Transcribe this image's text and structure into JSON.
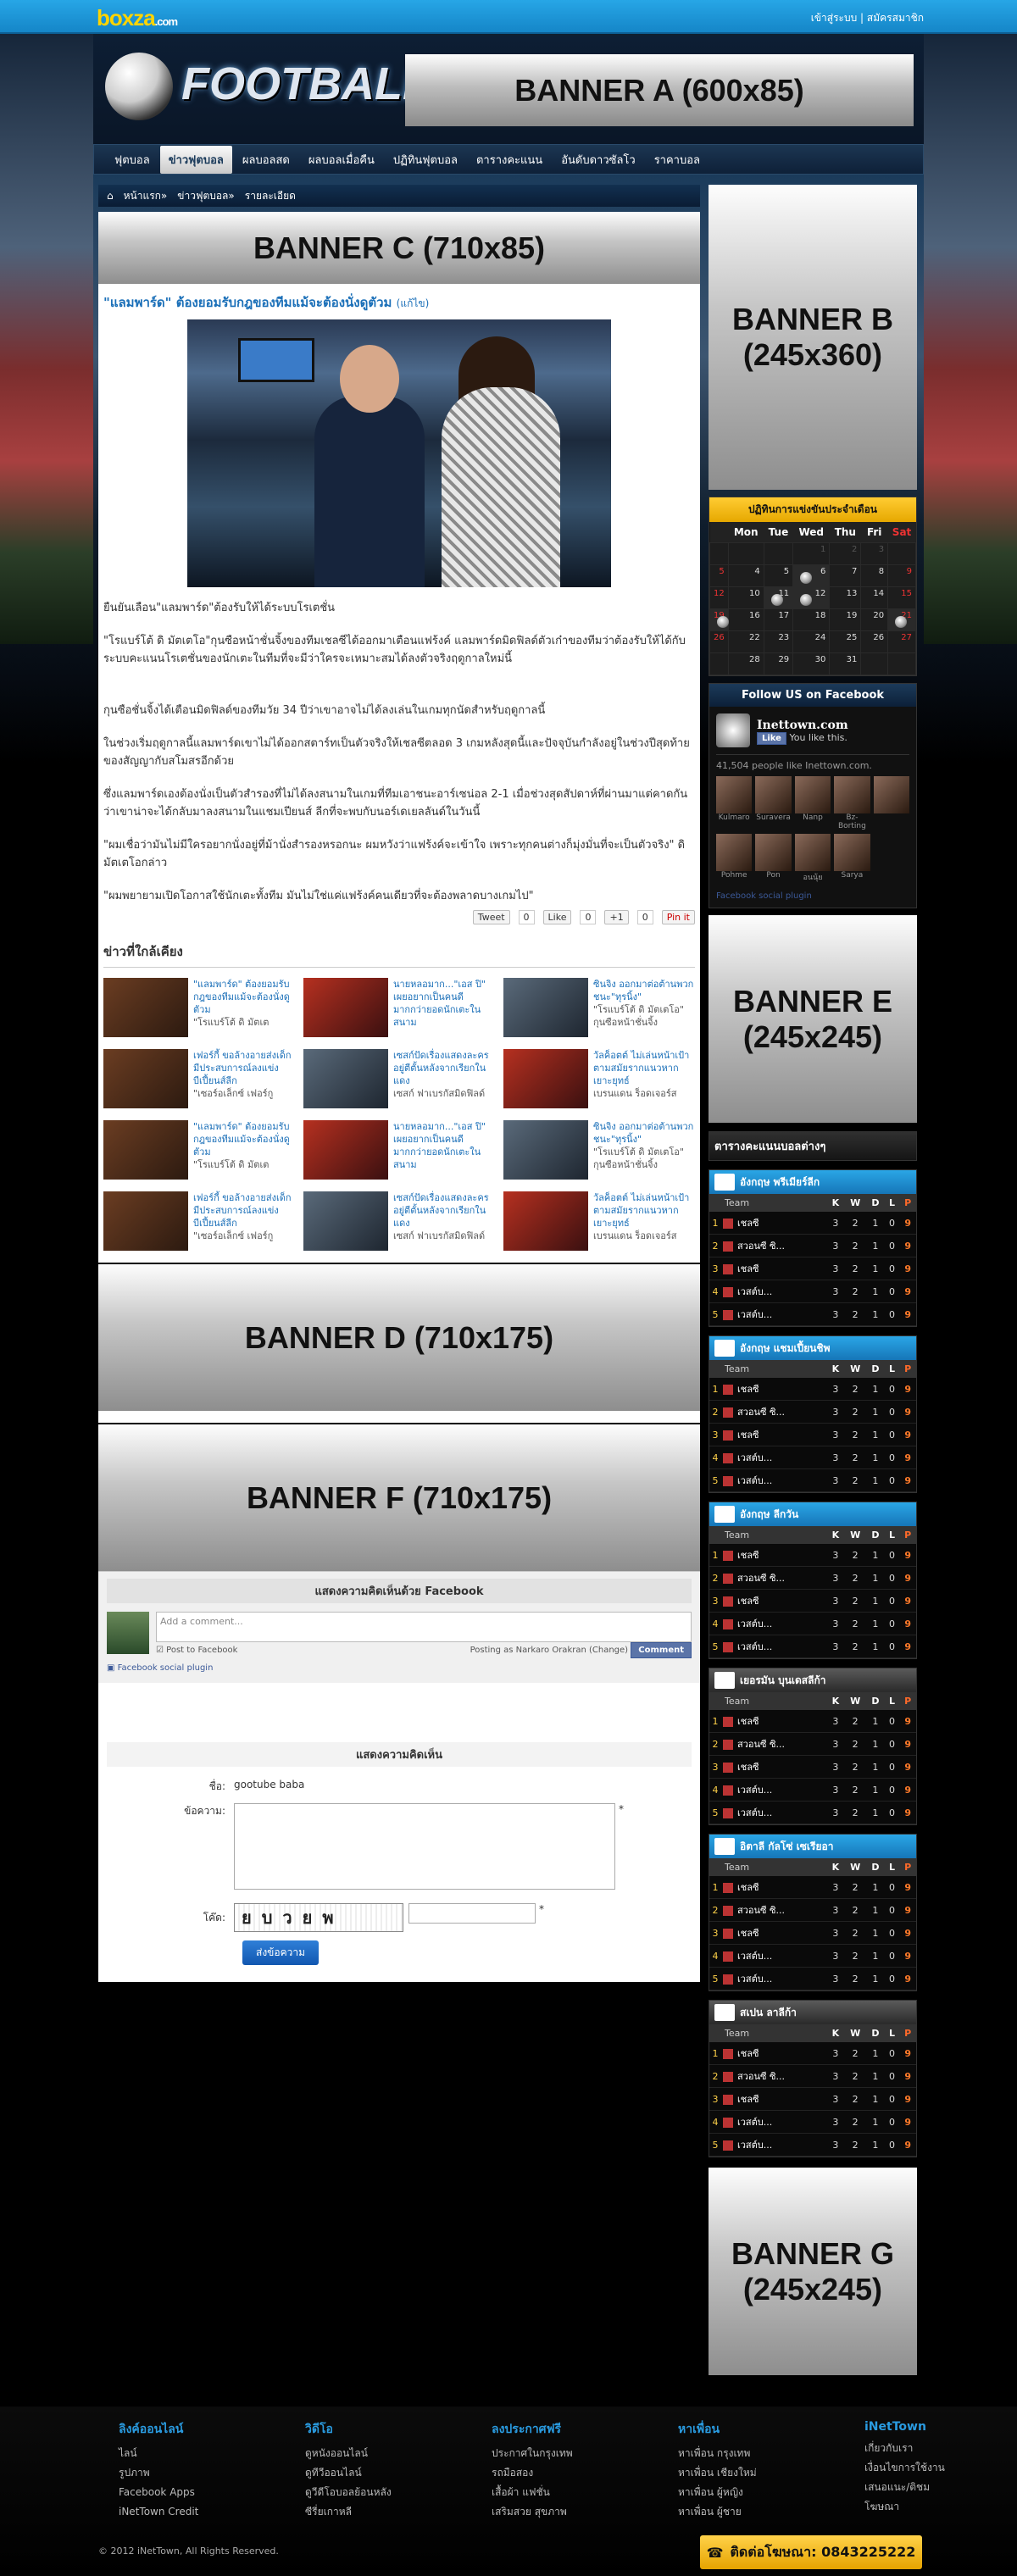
{
  "topbar": {
    "logo": "boxza",
    "logo_suffix": ".com",
    "login": "เข้าสู่ระบบ",
    "register": "สมัครสมาชิก"
  },
  "header": {
    "title": "FOOTBALL",
    "bannerA": "BANNER A (600x85)"
  },
  "nav": [
    "ฟุตบอล",
    "ข่าวฟุตบอล",
    "ผลบอลสด",
    "ผลบอลเมื่อคืน",
    "ปฏิทินฟุตบอล",
    "ตารางคะแนน",
    "อันดับดาวซัลโว",
    "ราคาบอล"
  ],
  "breadcrumb": {
    "home": "หน้าแรก",
    "section": "ข่าวฟุตบอล",
    "current": "รายละเอียด"
  },
  "banners": {
    "C": "BANNER C (710x85)",
    "B": "BANNER B (245x360)",
    "D": "BANNER D (710x175)",
    "F": "BANNER F (710x175)",
    "E": "BANNER E (245x245)",
    "G": "BANNER G (245x245)"
  },
  "article": {
    "title": "\"แลมพาร์ด\" ต้องยอมรับกฎของทีมแม้จะต้องนั่งดูตัวม",
    "title_suffix": "(แก้ไข)",
    "paragraphs": [
      "ยืนยันเลือน\"แลมพาร์ด\"ต้องรับให้ได้ระบบโรเตชั่น",
      "\"โรแบร์โต้ ดิ มัตเตโอ\"กุนซือหน้าชั่นจิ้งของทีมเชลซีได้ออกมาเตือนแฟร้งค์ แลมพาร์ดมิดฟิลด์ตัวเก๋าของทีมว่าต้องรับให้ได้กับระบบคะแนนโรเตชั่นของนักเตะในทีมที่จะมีว่าใครจะเหมาะสมได้ลงตัวจริงฤดูกาลใหม่นี้",
      "กุนซือชั่นจิ้งได้เตือนมิดฟิลด์ของทีมวัย 34 ปีว่าเขาอาจไม่ได้ลงเล่นในเกมทุกนัดสำหรับฤดูกาลนี้",
      "ในช่วงเริ่มฤดูกาลนี้แลมพาร์ดเขาไม่ได้ออกสตาร์ทเป็นตัวจริงให้เชลซีตลอด 3 เกมหลังสุดนี้และปัจจุบันกำลังอยู่ในช่วงปีสุดท้ายของสัญญากับสโมสรอีกด้วย",
      "ซึ่งแลมพาร์ดเองต้องนั่งเป็นตัวสำรองที่ไม่ได้ลงสนามในเกมที่ทีมเอาชนะอาร์เซน่อล 2-1 เมื่อช่วงสุดสัปดาห์ที่ผ่านมาแต่คาดกันว่าเขาน่าจะได้กลับมาลงสนามในแชมเปียนส์ ลีกที่จะพบกับนอร์เดเยลลันด์ในวันนี้",
      "\"ผมเชื่อว่ามันไม่มีใครอยากนั่งอยู่ที่ม้านั่งสำรองหรอกนะ ผมหวังว่าแฟร้งค์จะเข้าใจ เพราะทุกคนต่างก็มุ่งมั่นที่จะเป็นตัวจริง\" ดิ มัตเตโอกล่าว",
      "\"ผมพยายามเปิดโอกาสใช้นักเตะทั้งทีม มันไม่ใช่แค่แฟร้งค์คนเดียวที่จะต้องพลาดบางเกมไป\""
    ],
    "share": {
      "tweet": "Tweet",
      "tweet_count": "0",
      "like": "Like",
      "like_count": "0",
      "plus": "+1",
      "plus_count": "0",
      "pin": "Pin it"
    }
  },
  "related": {
    "heading": "ข่าวที่ใกล้เคียง",
    "items": [
      {
        "title": "\"แลมพาร์ด\" ต้องยอมรับกฎของทีมแม้จะต้องนั่งดูตัวม",
        "sub": "\"โรแบร์โต้ ดิ มัตเต"
      },
      {
        "title": "นายหลอมาก...\"เอส ปิ\" เผยอยากเป็นคนดีมากกว่ายอดนักเตะในสนาม",
        "sub": ""
      },
      {
        "title": "ซินจิง ออกมาต่อต้านพวกชนะ\"ทุรนิ้ง\"",
        "sub": "\"โรแบร์โต้ ดิ มัตเตโอ\" กุนซือหน้าชั่นจิ้ง"
      },
      {
        "title": "เฟอร์กี้ ขอล้างอายส่งเด็กมีประสบการณ์ลงแข่งบีเปี้ยนส์ลีก",
        "sub": "\"เซอร์อเล็กซ์ เฟอร์กู"
      },
      {
        "title": "เซสก์ปัดเรื่องแสดงละครอยู่ตีตั้นหลังจากเรียกในแดง",
        "sub": "เซสก์ ฟาเบรกัสมิดฟิลด์"
      },
      {
        "title": "วัลค็อตต์ ไม่เล่นหน้าเป้าตามสมัยรากแนวหากเยาะยุทธ์",
        "sub": "เบรนแดน ร็อดเจอร์ส"
      },
      {
        "title": "\"แลมพาร์ด\" ต้องยอมรับกฎของทีมแม้จะต้องนั่งดูตัวม",
        "sub": "\"โรแบร์โต้ ดิ มัตเต"
      },
      {
        "title": "นายหลอมาก...\"เอส ปิ\" เผยอยากเป็นคนดีมากกว่ายอดนักเตะในสนาม",
        "sub": ""
      },
      {
        "title": "ซินจิง ออกมาต่อต้านพวกชนะ\"ทุรนิ้ง\"",
        "sub": "\"โรแบร์โต้ ดิ มัตเตโอ\" กุนซือหน้าชั่นจิ้ง"
      },
      {
        "title": "เฟอร์กี้ ขอล้างอายส่งเด็กมีประสบการณ์ลงแข่งบีเปี้ยนส์ลีก",
        "sub": "\"เซอร์อเล็กซ์ เฟอร์กู"
      },
      {
        "title": "เซสก์ปัดเรื่องแสดงละครอยู่ตีตั้นหลังจากเรียกในแดง",
        "sub": "เซสก์ ฟาเบรกัสมิดฟิลด์"
      },
      {
        "title": "วัลค็อตต์ ไม่เล่นหน้าเป้าตามสมัยรากแนวหากเยาะยุทธ์",
        "sub": "เบรนแดน ร็อดเจอร์ส"
      }
    ]
  },
  "fbcomments": {
    "heading": "แสดงความคิดเห็นด้วย Facebook",
    "placeholder": "Add a comment...",
    "post_to_fb": "Post to Facebook",
    "posting_as": "Posting as Narkaro Orakran (Change)",
    "button": "Comment",
    "plugin": "Facebook social plugin"
  },
  "form": {
    "heading": "แสดงความคิดเห็น",
    "name_label": "ชื่อ:",
    "name_value": "gootube baba",
    "msg_label": "ข้อความ:",
    "code_label": "โค๊ด:",
    "captcha": "ยบวยพ",
    "submit": "ส่งข้อความ"
  },
  "calendar": {
    "heading": "ปฏิทินการแข่งขันประจำเดือน",
    "days": [
      "Mon",
      "Tue",
      "Wed",
      "Thu",
      "Fri",
      "Sat"
    ],
    "weeks": [
      [
        "",
        "",
        "",
        "",
        "",
        ""
      ],
      [
        "",
        "",
        "",
        "1",
        "2",
        "3"
      ],
      [
        "4",
        "5",
        "6",
        "7",
        "8",
        "9"
      ],
      [
        "10",
        "11",
        "12",
        "13",
        "14",
        "15"
      ],
      [
        "16",
        "17",
        "18",
        "19",
        "20",
        "21"
      ],
      [
        "22",
        "23",
        "24",
        "25",
        "26",
        "27"
      ],
      [
        "28",
        "29",
        "30",
        "31",
        "",
        ""
      ]
    ]
  },
  "facebook": {
    "heading": "Follow US on Facebook",
    "page": "Inettown.com",
    "like": "Like",
    "like_note": "You like this.",
    "count_text": "41,504 people like Inettown.com.",
    "names": [
      "Kulmaro",
      "Suravera",
      "Nanp",
      "Bz-Borting",
      "Pohme",
      "Pon",
      "อนนุ้ย",
      "Sarya"
    ],
    "plugin": "Facebook social plugin"
  },
  "leagues_heading": "ตารางคะแนนบอลต่างๆ",
  "leagues": [
    {
      "name": "อังกฤษ พรีเมียร์ลีก"
    },
    {
      "name": "อังกฤษ แชมเปี้ยนชิพ"
    },
    {
      "name": "อังกฤษ ลีกวัน"
    },
    {
      "name": "เยอรมัน บุนเดสลีก้า"
    },
    {
      "name": "อิตาลี กัลโซ่ เซเรียอา"
    },
    {
      "name": "สเปน ลาลีก้า"
    }
  ],
  "table_head": {
    "team": "Team",
    "k": "K",
    "w": "W",
    "d": "D",
    "l": "L",
    "p": "P"
  },
  "table_rows": [
    {
      "n": "1",
      "team": "เชลซี",
      "k": "3",
      "w": "2",
      "d": "1",
      "l": "0",
      "p": "9"
    },
    {
      "n": "2",
      "team": "สวอนซี ซิ...",
      "k": "3",
      "w": "2",
      "d": "1",
      "l": "0",
      "p": "9"
    },
    {
      "n": "3",
      "team": "เชลซี",
      "k": "3",
      "w": "2",
      "d": "1",
      "l": "0",
      "p": "9"
    },
    {
      "n": "4",
      "team": "เวสต์บ...",
      "k": "3",
      "w": "2",
      "d": "1",
      "l": "0",
      "p": "9"
    },
    {
      "n": "5",
      "team": "เวสต์บ...",
      "k": "3",
      "w": "2",
      "d": "1",
      "l": "0",
      "p": "9"
    }
  ],
  "footer": {
    "cols": [
      {
        "title": "ลิงค์ออนไลน์",
        "items": [
          "ไลน์",
          "รูปภาพ",
          "Facebook Apps",
          "iNetTown Credit"
        ]
      },
      {
        "title": "วิดีโอ",
        "items": [
          "ดูหนังออนไลน์",
          "ดูทีวีออนไลน์",
          "ดูวีดีโอบอลย้อนหลัง",
          "ซีรี่ยเกาหลี"
        ]
      },
      {
        "title": "ลงประกาศฟรี",
        "items": [
          "ประกาศในกรุงเทพ",
          "รถมือสอง",
          "เสื้อผ้า แฟชั่น",
          "เสริมสวย สุขภาพ"
        ]
      },
      {
        "title": "หาเพื่อน",
        "items": [
          "หาเพื่อน กรุงเทพ",
          "หาเพื่อน เชียงใหม่",
          "หาเพื่อน ผู้หญิง",
          "หาเพื่อน ผู้ชาย"
        ]
      },
      {
        "title": "iNetTown",
        "items": [
          "เกี่ยวกับเรา",
          "เงื่อนไขการใช้งาน",
          "เสนอแนะ/ติชม",
          "โฆษณา"
        ]
      }
    ],
    "copyright": "© 2012 iNetTown, All Rights Reserved.",
    "phone": "ติดต่อโฆษณา: 0843225222"
  }
}
